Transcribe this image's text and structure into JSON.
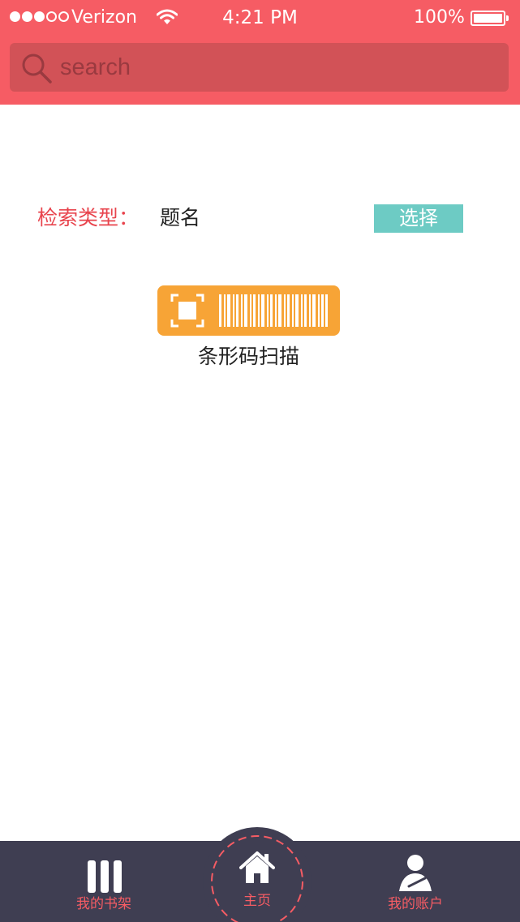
{
  "status_bar": {
    "carrier": "Verizon",
    "time": "4:21 PM",
    "battery": "100%",
    "signal_bars_filled": 3,
    "signal_bars_total": 5
  },
  "search": {
    "placeholder": "search"
  },
  "search_type": {
    "label": "检索类型：",
    "value": "题名",
    "button_label": "选择"
  },
  "scanner": {
    "label": "条形码扫描"
  },
  "tab_bar": {
    "items": [
      {
        "label": "我的书架",
        "icon": "bookshelf-icon"
      },
      {
        "label": "主页",
        "icon": "home-icon"
      },
      {
        "label": "我的账户",
        "icon": "user-icon"
      }
    ]
  },
  "colors": {
    "header": "#f65c64",
    "search_box": "#d25257",
    "accent_label": "#e8444d",
    "select_button": "#6dcbc4",
    "scan_button": "#f7a436",
    "tab_bar": "#3f3e52"
  }
}
